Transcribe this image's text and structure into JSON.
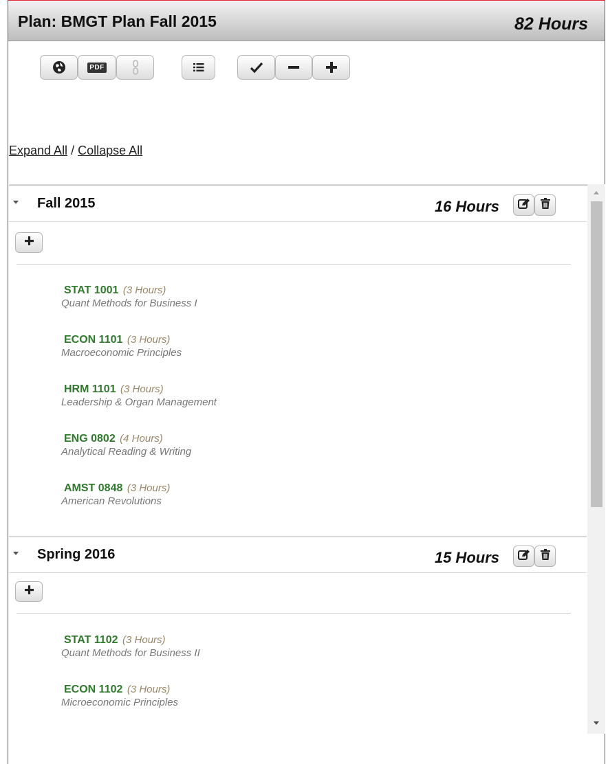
{
  "plan": {
    "title": "Plan: BMGT Plan Fall 2015",
    "total_hours": "82 Hours"
  },
  "toolbar": {
    "pdf_label": "PDF",
    "buttons": [
      "globe-icon",
      "pdf-icon",
      "link-icon",
      "list-icon",
      "check-icon",
      "minus-icon",
      "plus-icon"
    ]
  },
  "expand": {
    "expand_all": "Expand All",
    "separator": " / ",
    "collapse_all": "Collapse All"
  },
  "terms": [
    {
      "name": "Fall 2015",
      "hours": "16 Hours",
      "courses": [
        {
          "code": "STAT 1001",
          "hours": "(3 Hours)",
          "title": "Quant Methods for Business I"
        },
        {
          "code": "ECON 1101",
          "hours": "(3 Hours)",
          "title": "Macroeconomic Principles"
        },
        {
          "code": "HRM 1101",
          "hours": "(3 Hours)",
          "title": "Leadership & Organ Management"
        },
        {
          "code": "ENG 0802",
          "hours": "(4 Hours)",
          "title": "Analytical Reading & Writing"
        },
        {
          "code": "AMST 0848",
          "hours": "(3 Hours)",
          "title": "American Revolutions"
        }
      ]
    },
    {
      "name": "Spring 2016",
      "hours": "15 Hours",
      "courses": [
        {
          "code": "STAT 1102",
          "hours": "(3 Hours)",
          "title": "Quant Methods for Business II"
        },
        {
          "code": "ECON 1102",
          "hours": "(3 Hours)",
          "title": "Microeconomic Principles"
        }
      ]
    }
  ],
  "colors": {
    "course_code": "#2f7a2c",
    "course_hours": "#9a8767",
    "course_title": "#777777",
    "frame_border": "#e0262e"
  }
}
